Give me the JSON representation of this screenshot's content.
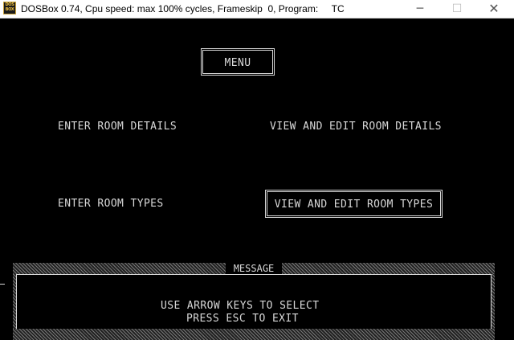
{
  "window": {
    "title": "DOSBox 0.74, Cpu speed: max 100% cycles, Frameskip  0, Program:     TC",
    "icon_text_top": "DOS",
    "icon_text_bottom": "BOX",
    "minimize_glyph": "─",
    "maximize_glyph": "☐",
    "close_glyph": "✕"
  },
  "menu": {
    "title": "MENU",
    "items": [
      {
        "label": "ENTER ROOM DETAILS",
        "selected": false
      },
      {
        "label": "VIEW AND EDIT ROOM DETAILS",
        "selected": false
      },
      {
        "label": "ENTER ROOM TYPES",
        "selected": false
      },
      {
        "label": "VIEW AND EDIT ROOM TYPES",
        "selected": true
      }
    ]
  },
  "message": {
    "title": "MESSAGE",
    "line1": "USE ARROW KEYS TO SELECT",
    "line2": "PRESS ESC TO EXIT"
  },
  "colors": {
    "screen_bg": "#000000",
    "text": "#d8d8d8",
    "titlebar_bg": "#ffffff"
  },
  "icons": [
    "dosbox-app-icon",
    "minimize-icon",
    "maximize-icon",
    "close-icon"
  ]
}
